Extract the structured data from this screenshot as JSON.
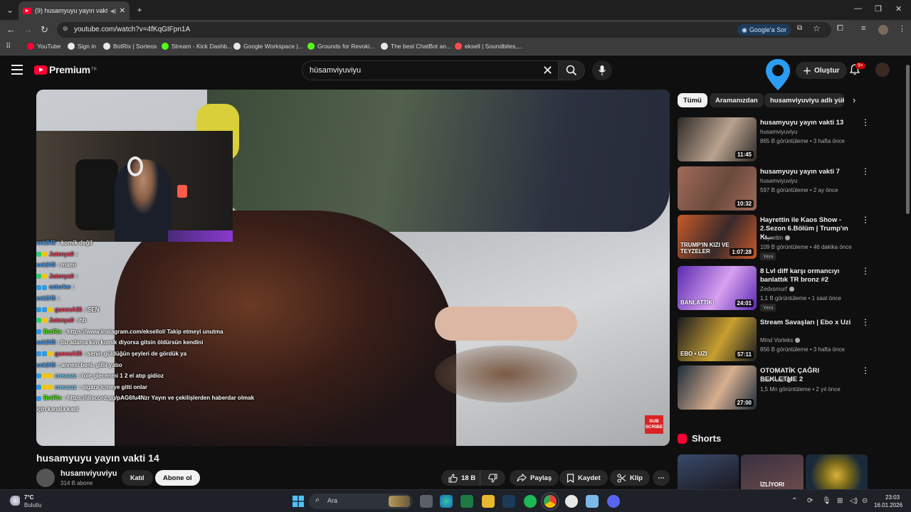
{
  "browser": {
    "tab_title": "(9) husamyuyu yayın vakti",
    "url": "youtube.com/watch?v=4fKqGIFpn1A",
    "google_ask": "Google'a Sor",
    "bookmarks": [
      {
        "label": "YouTube",
        "color": "#ff0033"
      },
      {
        "label": "Sign in",
        "color": "#e8e8e8"
      },
      {
        "label": "BotRix | Sorteos",
        "color": "#e8e8e8"
      },
      {
        "label": "Stream - Kick Dashb...",
        "color": "#53fc18"
      },
      {
        "label": "Google Workspace |...",
        "color": "#e8e8e8"
      },
      {
        "label": "Grounds for Revoki...",
        "color": "#53fc18"
      },
      {
        "label": "The best ChatBot an...",
        "color": "#e8e8e8"
      },
      {
        "label": "eksell | Soundbites,...",
        "color": "#ff4d4d"
      }
    ]
  },
  "youtube": {
    "logo_text": "Premium",
    "logo_sup": "TR",
    "search_value": "hüsamviyuviyu",
    "create_label": "Oluştur",
    "notif_badge": "9+",
    "video": {
      "title": "husamyuyu yayın vakti 14",
      "channel": "husamviyuviyu",
      "subs": "314 B abone",
      "join_label": "Katıl",
      "subscribe_label": "Abone ol",
      "likes": "18 B",
      "share_label": "Paylaş",
      "save_label": "Kaydet",
      "clip_label": "Klip",
      "overlay_subscribe": "SUB SCRIBE"
    },
    "chat": [
      {
        "user": "snk345",
        "color": "#4aa3ff",
        "msg": "komik değil",
        "badges": []
      },
      {
        "user": "Jutenya0",
        "color": "#ff3b5c",
        "msg": "",
        "badges": [
          "#2ecc71",
          "#f1c40f"
        ]
      },
      {
        "user": "snk345",
        "color": "#4aa3ff",
        "msg": "mami",
        "badges": []
      },
      {
        "user": "Jutenya0",
        "color": "#ff3b5c",
        "msg": "",
        "badges": [
          "#2ecc71",
          "#f1c40f"
        ]
      },
      {
        "user": "ozturkw",
        "color": "#4aa3ff",
        "msg": "",
        "badges": [
          "#3498db",
          "#3498db"
        ]
      },
      {
        "user": "snk345",
        "color": "#4aa3ff",
        "msg": "",
        "badges": []
      },
      {
        "user": "gunesA36",
        "color": "#ff3b5c",
        "msg": "SEN",
        "badges": [
          "#3498db",
          "#3498db",
          "#f1c40f"
        ]
      },
      {
        "user": "Jutenya0",
        "color": "#ff3b5c",
        "msg": "hb",
        "badges": [
          "#2ecc71",
          "#f1c40f"
        ]
      },
      {
        "user": "BotRix",
        "color": "#53fc18",
        "msg": "https://www.instagram.com/eksellol/ Takip etmeyi unutma",
        "badges": [
          "#3498db"
        ]
      },
      {
        "user": "snk345",
        "color": "#4aa3ff",
        "msg": "bu adama kim komik diyorsa gitsin öldürsün kendini",
        "badges": []
      },
      {
        "user": "gunesA36",
        "color": "#ff3b5c",
        "msg": "senin güldüğün şeyleri de gördük ya",
        "badges": [
          "#3498db",
          "#3498db",
          "#f1c40f"
        ]
      },
      {
        "user": "snk345",
        "color": "#4aa3ff",
        "msg": "annesi beni. gilbi yatıo",
        "badges": []
      },
      {
        "user": "cneaxzz",
        "color": "#7fd3ff",
        "msg": "lole glecenmi 1 2 el atıp gidioz",
        "badges": [
          "#3498db",
          "#f1c40f",
          "#f1c40f"
        ]
      },
      {
        "user": "cneaxzz",
        "color": "#7fd3ff",
        "msg": "sigara icmeye gitti onlar",
        "badges": [
          "#3498db",
          "#f1c40f",
          "#f1c40f"
        ]
      },
      {
        "user": "BotRix",
        "color": "#53fc18",
        "msg": "https://discord.gg/pAG6fu4Nzr Yayın ve çekilişlerden haberdar olmak",
        "badges": [
          "#3498db"
        ]
      },
      {
        "user": "",
        "color": "#ffffff",
        "msg": "için kanala katıl",
        "badges": []
      }
    ],
    "chips": [
      "Tümü",
      "Aramanızdan",
      "husamviyuviyu adlı yükleyiciden"
    ],
    "recommendations": [
      {
        "title": "husamyuyu yayın vakti 13",
        "channel": "husamviyuviyu",
        "verified": false,
        "meta": "865 B görüntüleme • 3 hafta önce",
        "duration": "11:45",
        "new": "",
        "thumb": [
          "#2e2a27",
          "#b9a28f"
        ]
      },
      {
        "title": "husamyuyu yayın vakti 7",
        "channel": "husamviyuviyu",
        "verified": false,
        "meta": "597 B görüntüleme • 2 ay önce",
        "duration": "10:32",
        "new": "",
        "thumb": [
          "#a06a5a",
          "#6a4a3c"
        ]
      },
      {
        "title": "Hayrettin ile Kaos Show - 2.Sezon 6.Bölüm | Trump'ın Kı...",
        "channel": "Hayrettin",
        "verified": true,
        "meta": "109 B görüntüleme • 46 dakika önce",
        "duration": "1:07:28",
        "new": "Yeni",
        "thumb": [
          "#c85a2a",
          "#3a2a2a"
        ]
      },
      {
        "title": "8 Lvl diff karşı ormancıyı banlattık TR bronz #2",
        "channel": "Zedxsmurf",
        "verified": true,
        "meta": "1,1 B görüntüleme • 1 saat önce",
        "duration": "24:01",
        "new": "Yeni",
        "thumb": [
          "#5a2ab0",
          "#d8a0f0"
        ]
      },
      {
        "title": "Stream Savaşları | Ebo x Uzi",
        "channel": "Mind Vorteks",
        "verified": true,
        "meta": "856 B görüntüleme • 3 hafta önce",
        "duration": "57:11",
        "new": "",
        "thumb": [
          "#1a1a22",
          "#c8a030"
        ]
      },
      {
        "title": "OTOMATİK ÇAĞRI BEKLETME 2",
        "channel": "İlker Fırat",
        "verified": true,
        "meta": "1,5 Mn görüntüleme • 2 yıl önce",
        "duration": "27:00",
        "new": "",
        "thumb": [
          "#1e2c3a",
          "#d8b090"
        ]
      }
    ],
    "thumb_texts": {
      "trump": "TRUMP'IN KIZI VE TEYZELER",
      "banlattik": "BANLATTIK!",
      "ebo": "EBO • UZI",
      "izliyor": "İZLİYORI"
    },
    "shorts_title": "Shorts"
  },
  "taskbar": {
    "temp": "7°C",
    "weather": "Bulutlu",
    "search": "Ara",
    "time": "23:03",
    "date": "16.01.2026"
  }
}
